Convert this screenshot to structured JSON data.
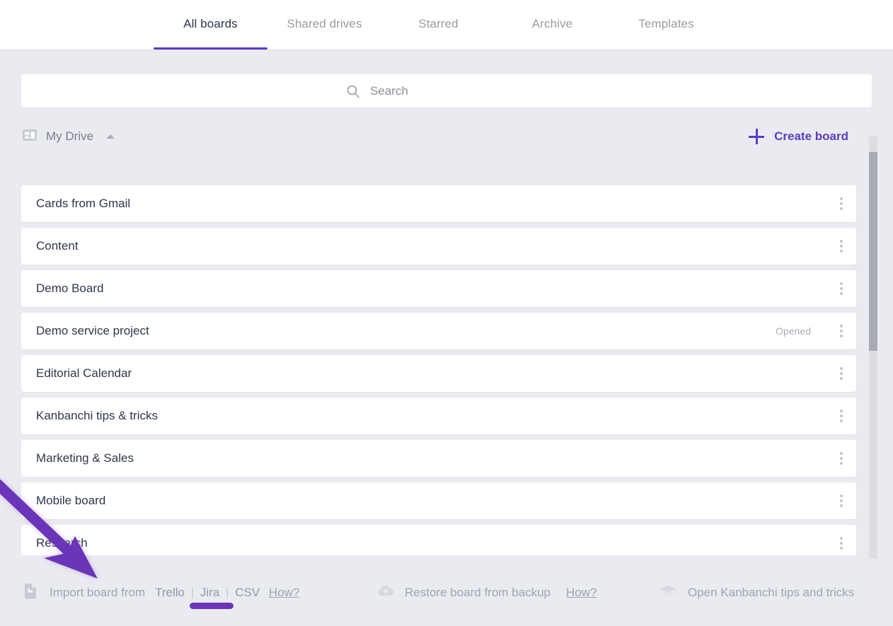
{
  "tabs": [
    {
      "label": "All boards",
      "active": true
    },
    {
      "label": "Shared drives",
      "active": false
    },
    {
      "label": "Starred",
      "active": false
    },
    {
      "label": "Archive",
      "active": false
    },
    {
      "label": "Templates",
      "active": false
    }
  ],
  "search": {
    "placeholder": "Search",
    "value": "",
    "icon": "search-icon"
  },
  "drive": {
    "label": "My Drive",
    "icon": "board-grid-icon",
    "collapse_icon": "caret-up-icon",
    "create_label": "Create board",
    "create_icon": "plus-icon",
    "accent_color": "#5b3cc4"
  },
  "boards": [
    {
      "name": "Cards from Gmail",
      "status": ""
    },
    {
      "name": "Content",
      "status": ""
    },
    {
      "name": "Demo Board",
      "status": ""
    },
    {
      "name": "Demo service project",
      "status": "Opened"
    },
    {
      "name": "Editorial Calendar",
      "status": ""
    },
    {
      "name": "Kanbanchi tips & tricks",
      "status": ""
    },
    {
      "name": "Marketing & Sales",
      "status": ""
    },
    {
      "name": "Mobile board",
      "status": ""
    },
    {
      "name": "Research",
      "status": ""
    }
  ],
  "footer": {
    "import": {
      "icon": "import-file-icon",
      "label": "Import board from",
      "sources": [
        "Trello",
        "Jira",
        "CSV"
      ],
      "separator": "|",
      "how_label": "How?",
      "highlighted_source": "Jira"
    },
    "restore": {
      "icon": "cloud-upload-icon",
      "label": "Restore board from backup",
      "how_label": "How?"
    },
    "tips": {
      "icon": "graduation-cap-icon",
      "label": "Open Kanbanchi tips and tricks"
    }
  },
  "annotation": {
    "type": "arrow",
    "color": "#6a35b8",
    "points_to": "Jira"
  },
  "colors": {
    "page_background": "#eaebf0",
    "card_background": "#ffffff",
    "accent_purple": "#5b3cc4",
    "annotation_purple": "#6a35b8",
    "text_primary": "#2c3748",
    "text_muted": "#a0a4ae"
  }
}
